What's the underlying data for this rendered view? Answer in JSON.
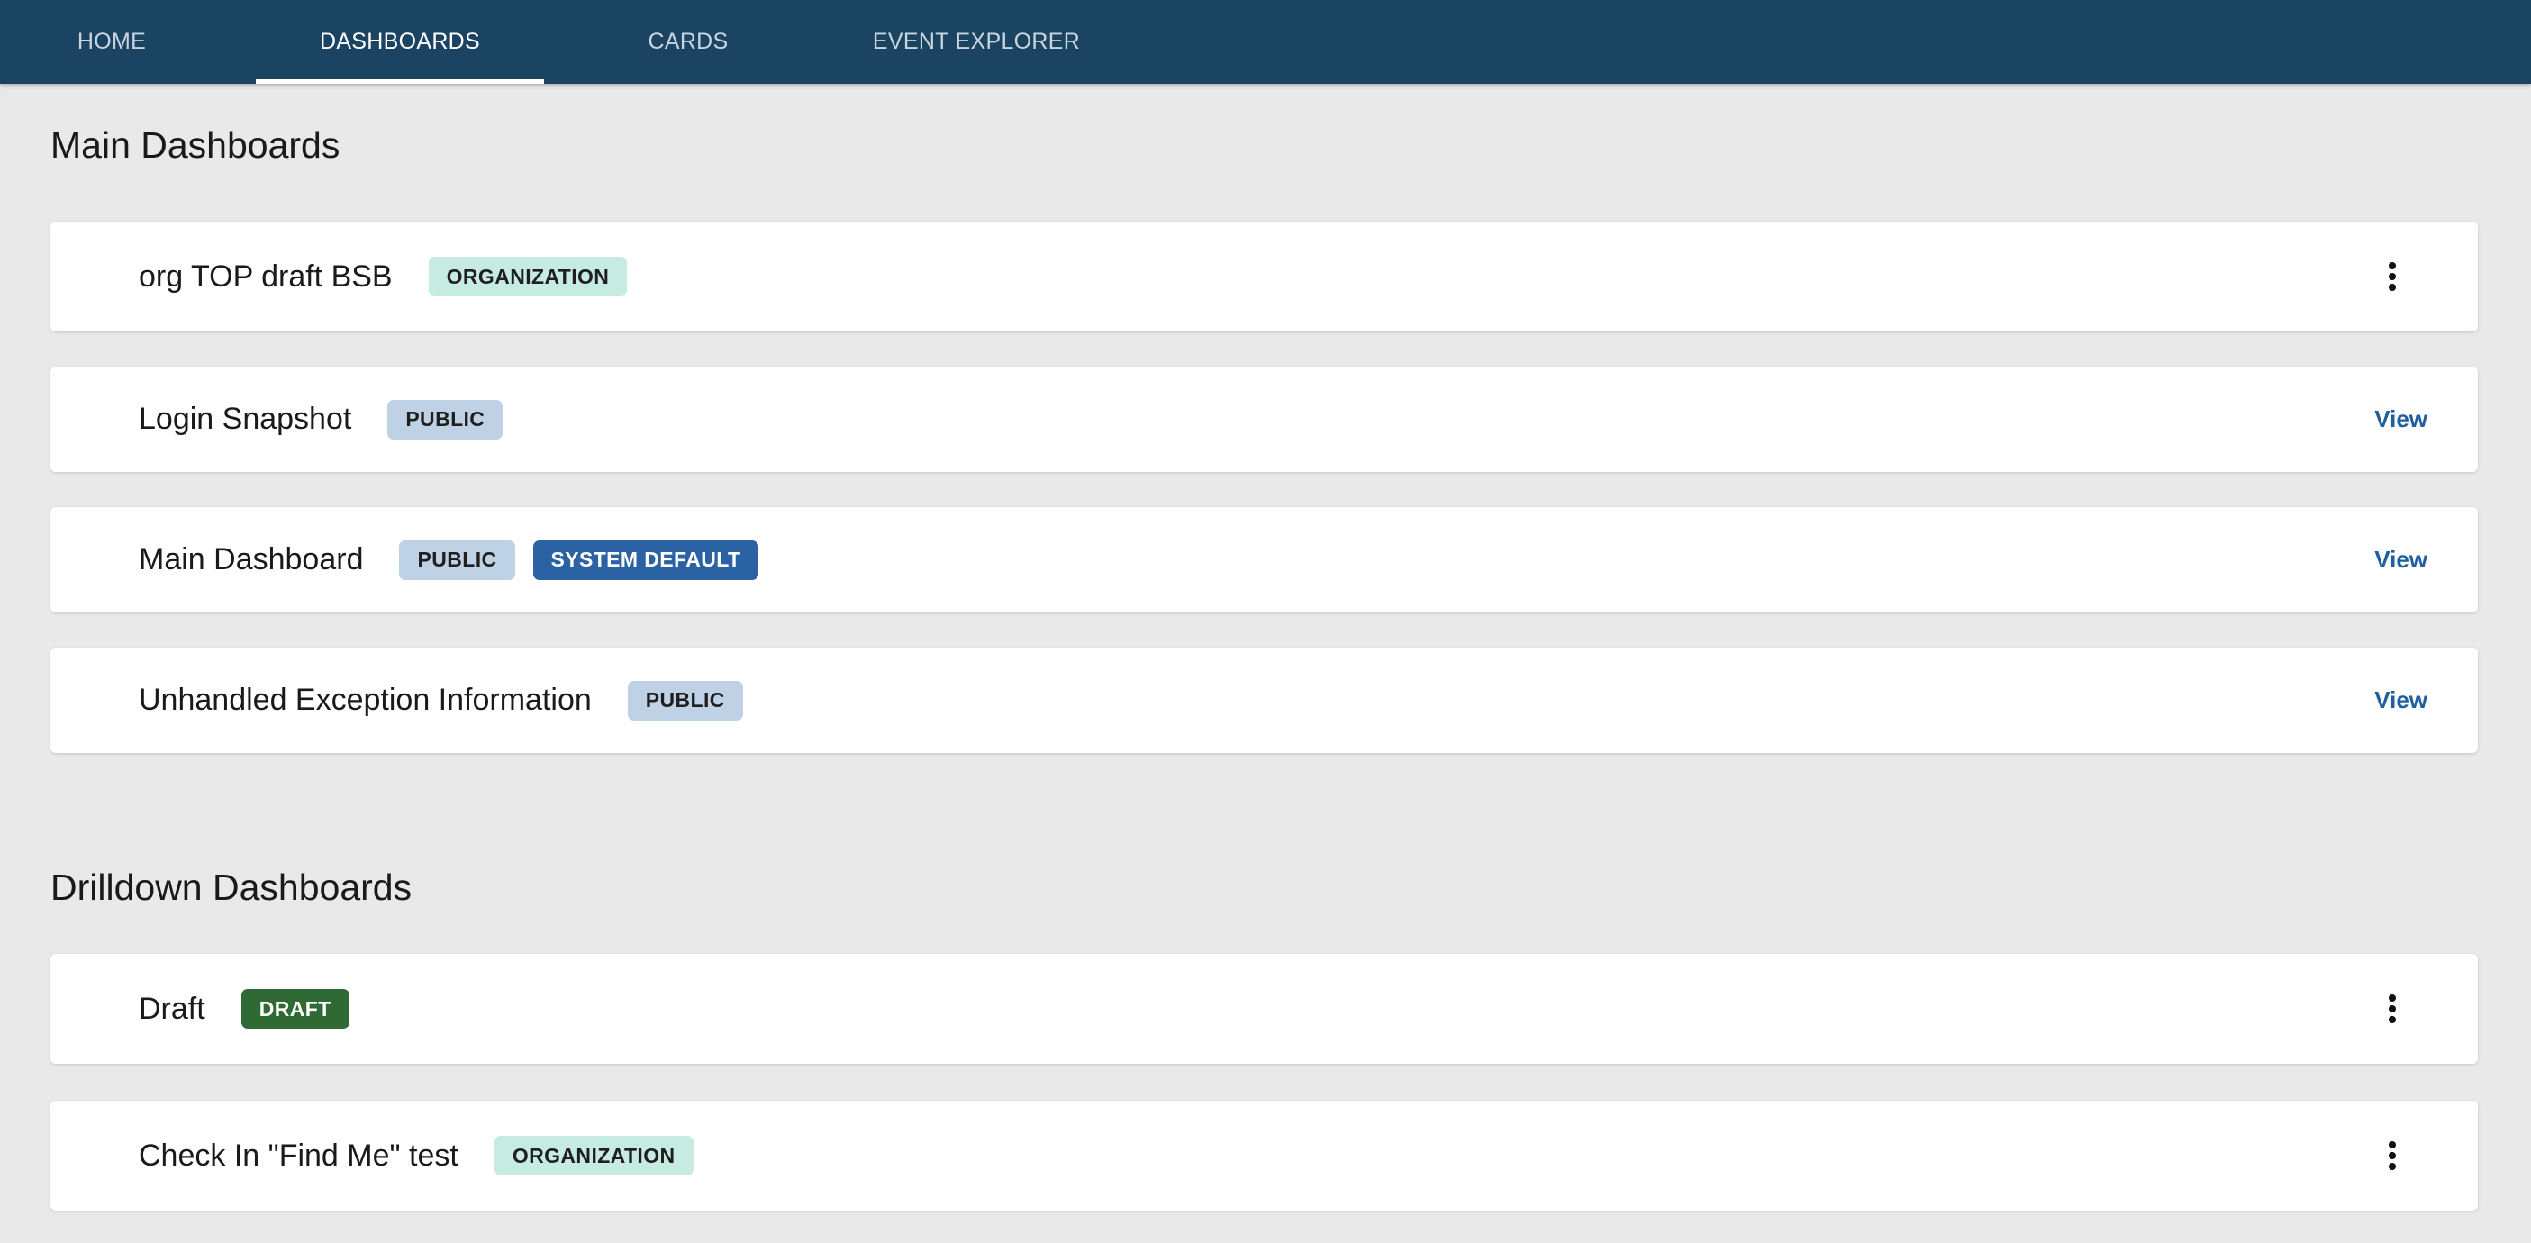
{
  "nav": {
    "tabs": [
      {
        "label": "HOME"
      },
      {
        "label": "DASHBOARDS"
      },
      {
        "label": "CARDS"
      },
      {
        "label": "EVENT EXPLORER"
      }
    ]
  },
  "main_section": {
    "title": "Main Dashboards",
    "items": [
      {
        "title": "org TOP draft BSB",
        "badges": [
          "ORGANIZATION"
        ],
        "action": "more-icon"
      },
      {
        "title": "Login Snapshot",
        "badges": [
          "PUBLIC"
        ],
        "action_label": "View"
      },
      {
        "title": "Main Dashboard",
        "badges": [
          "PUBLIC",
          "SYSTEM DEFAULT"
        ],
        "action_label": "View"
      },
      {
        "title": "Unhandled Exception Information",
        "badges": [
          "PUBLIC"
        ],
        "action_label": "View"
      }
    ]
  },
  "drilldown_section": {
    "title": "Drilldown Dashboards",
    "items": [
      {
        "title": "Draft",
        "badges": [
          "DRAFT"
        ],
        "action": "more-icon"
      },
      {
        "title": "Check In \"Find Me\" test",
        "badges": [
          "ORGANIZATION"
        ],
        "action": "more-icon"
      }
    ]
  },
  "colors": {
    "nav_background": "#1b4463",
    "page_background": "#e9e9e9",
    "badge_organization": "#c6ebe1",
    "badge_public": "#bfd2e5",
    "badge_system_default": "#2a62a3",
    "badge_draft": "#2f6934",
    "link": "#1f5f9e"
  }
}
